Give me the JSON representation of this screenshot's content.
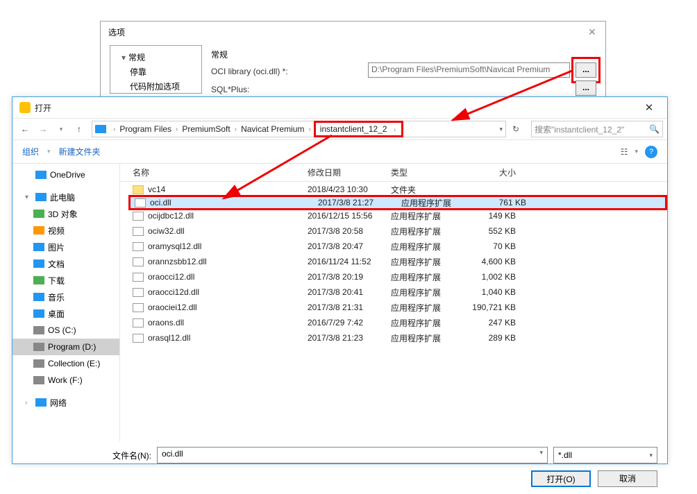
{
  "options": {
    "title": "选项",
    "tree": {
      "root": "常规",
      "child1": "停靠",
      "child2": "代码附加选项"
    },
    "section": "常规",
    "oci_label": "OCI library (oci.dll) *:",
    "oci_value": "D:\\Program Files\\PremiumSoft\\Navicat Premium",
    "sqlplus_label": "SQL*Plus:",
    "browse": "..."
  },
  "open": {
    "title": "打开",
    "breadcrumb": [
      "Program Files",
      "PremiumSoft",
      "Navicat Premium",
      "instantclient_12_2"
    ],
    "search_placeholder": "搜索\"instantclient_12_2\"",
    "toolbar": {
      "organize": "组织",
      "newfolder": "新建文件夹"
    },
    "sidebar": {
      "onedrive": "OneDrive",
      "thispc": "此电脑",
      "d3": "3D 对象",
      "video": "视频",
      "pictures": "图片",
      "documents": "文档",
      "downloads": "下载",
      "music": "音乐",
      "desktop": "桌面",
      "osc": "OS (C:)",
      "progd": "Program (D:)",
      "colle": "Collection (E:)",
      "workf": "Work (F:)",
      "network": "网络"
    },
    "headers": {
      "name": "名称",
      "date": "修改日期",
      "type": "类型",
      "size": "大小"
    },
    "files": [
      {
        "name": "vc14",
        "date": "2018/4/23 10:30",
        "type": "文件夹",
        "size": "",
        "folder": true
      },
      {
        "name": "oci.dll",
        "date": "2017/3/8 21:27",
        "type": "应用程序扩展",
        "size": "761 KB",
        "selected": true
      },
      {
        "name": "ocijdbc12.dll",
        "date": "2016/12/15 15:56",
        "type": "应用程序扩展",
        "size": "149 KB"
      },
      {
        "name": "ociw32.dll",
        "date": "2017/3/8 20:58",
        "type": "应用程序扩展",
        "size": "552 KB"
      },
      {
        "name": "oramysql12.dll",
        "date": "2017/3/8 20:47",
        "type": "应用程序扩展",
        "size": "70 KB"
      },
      {
        "name": "orannzsbb12.dll",
        "date": "2016/11/24 11:52",
        "type": "应用程序扩展",
        "size": "4,600 KB"
      },
      {
        "name": "oraocci12.dll",
        "date": "2017/3/8 20:19",
        "type": "应用程序扩展",
        "size": "1,002 KB"
      },
      {
        "name": "oraocci12d.dll",
        "date": "2017/3/8 20:41",
        "type": "应用程序扩展",
        "size": "1,040 KB"
      },
      {
        "name": "oraociei12.dll",
        "date": "2017/3/8 21:31",
        "type": "应用程序扩展",
        "size": "190,721 KB"
      },
      {
        "name": "oraons.dll",
        "date": "2016/7/29 7:42",
        "type": "应用程序扩展",
        "size": "247 KB"
      },
      {
        "name": "orasql12.dll",
        "date": "2017/3/8 21:23",
        "type": "应用程序扩展",
        "size": "289 KB"
      }
    ],
    "filename_label": "文件名(N):",
    "filename_value": "oci.dll",
    "filter": "*.dll",
    "open_btn": "打开(O)",
    "cancel_btn": "取消"
  }
}
